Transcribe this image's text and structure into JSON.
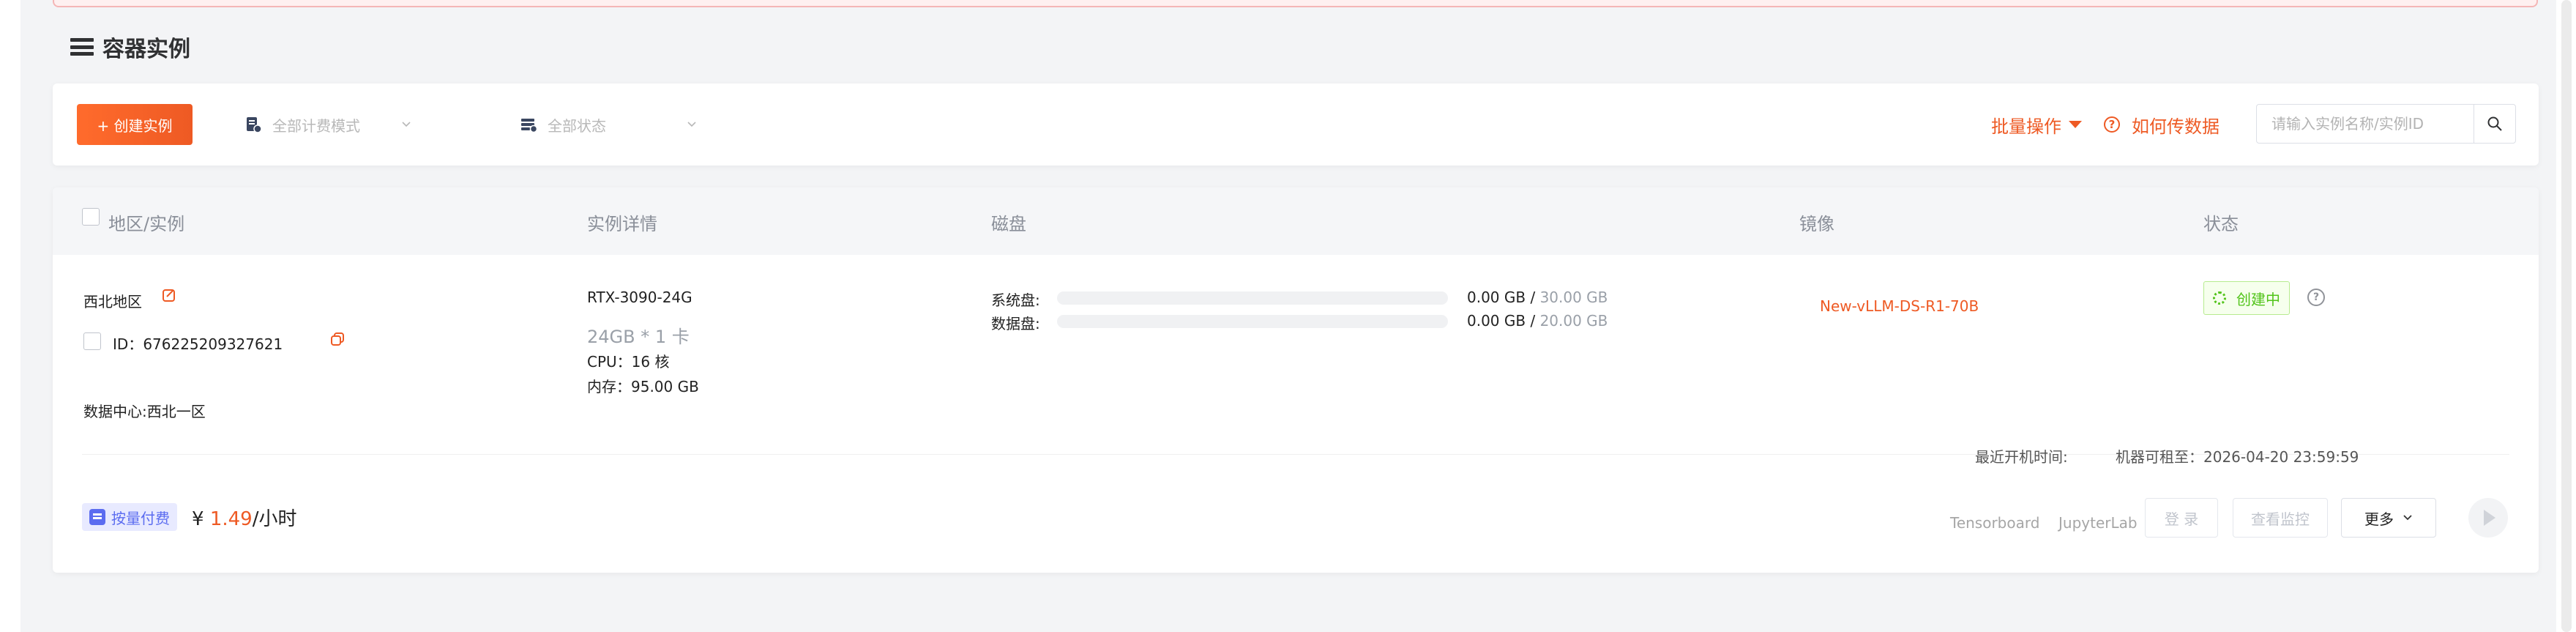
{
  "page": {
    "title": "容器实例"
  },
  "toolbar": {
    "create_label": "+ 创建实例",
    "billing_filter": "全部计费模式",
    "status_filter": "全部状态",
    "batch_label": "批量操作",
    "howto_label": "如何传数据",
    "search_placeholder": "请输入实例名称/实例ID"
  },
  "table": {
    "headers": [
      "地区/实例",
      "实例详情",
      "磁盘",
      "镜像",
      "状态"
    ]
  },
  "instance": {
    "region": "西北地区",
    "id_label": "ID：",
    "id": "676225209327621",
    "datacenter": "数据中心:西北一区",
    "gpu_model": "RTX-3090-24G",
    "gpu_spec": "24GB * 1 卡",
    "cpu": "CPU：16 核",
    "memory": "内存：95.00 GB",
    "system_disk_label": "系统盘:",
    "system_disk_used": "0.00 GB",
    "system_disk_total": "30.00 GB",
    "data_disk_label": "数据盘:",
    "data_disk_used": "0.00 GB",
    "data_disk_total": "20.00 GB",
    "disk_separator": " / ",
    "image": "New-vLLM-DS-R1-70B",
    "status": "创建中",
    "last_boot_label": "最近开机时间:",
    "rentable_until": "机器可租至：2026-04-20 23:59:59",
    "billing_mode": "按量付费",
    "price_currency": "¥",
    "price_value": "1.49",
    "price_unit": "/小时"
  },
  "actions": {
    "tensorboard": "Tensorboard",
    "jupyterlab": "JupyterLab",
    "login": "登 录",
    "monitor": "查看监控",
    "more": "更多"
  },
  "colors": {
    "accent": "#ee5a24",
    "status_green": "#52c41a",
    "billing_badge": "#5b6cf0"
  }
}
